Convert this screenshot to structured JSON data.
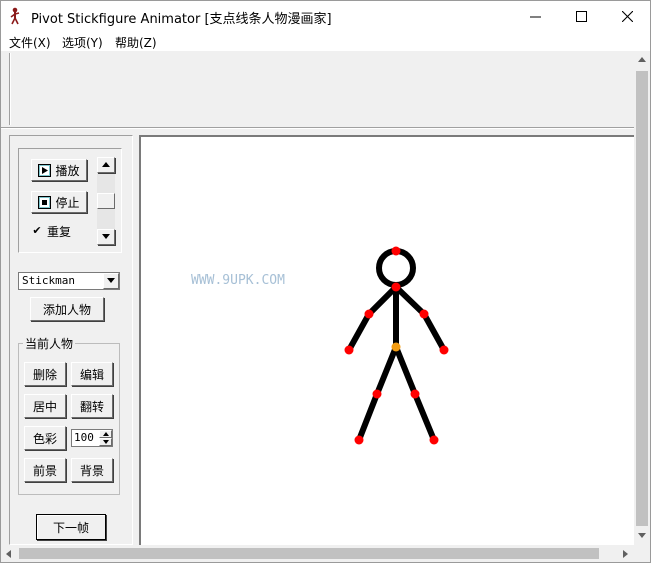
{
  "window": {
    "title": "Pivot Stickfigure Animator [支点线条人物漫画家]"
  },
  "menu": {
    "file": "文件(X)",
    "options": "选项(Y)",
    "help": "帮助(Z)"
  },
  "playback": {
    "play_label": "播放",
    "stop_label": "停止",
    "repeat_label": "重复",
    "repeat_checked": true
  },
  "figure_select": {
    "value": "Stickman"
  },
  "add_figure_label": "添加人物",
  "current_figure": {
    "group_label": "当前人物",
    "delete_label": "删除",
    "edit_label": "编辑",
    "center_label": "居中",
    "flip_label": "翻转",
    "color_label": "色彩",
    "size_value": "100",
    "front_label": "前景",
    "back_label": "背景"
  },
  "next_frame_label": "下一帧",
  "canvas": {
    "watermark": "WWW.9UPK.COM"
  },
  "colors": {
    "handle": "#ff0000",
    "center_handle": "#f39c12",
    "figure": "#000000"
  },
  "icons": [
    "app-figure-icon",
    "minimize-icon",
    "maximize-icon",
    "close-icon",
    "play-icon",
    "stop-icon",
    "chevron-down-icon",
    "spin-up-icon",
    "spin-down-icon"
  ]
}
